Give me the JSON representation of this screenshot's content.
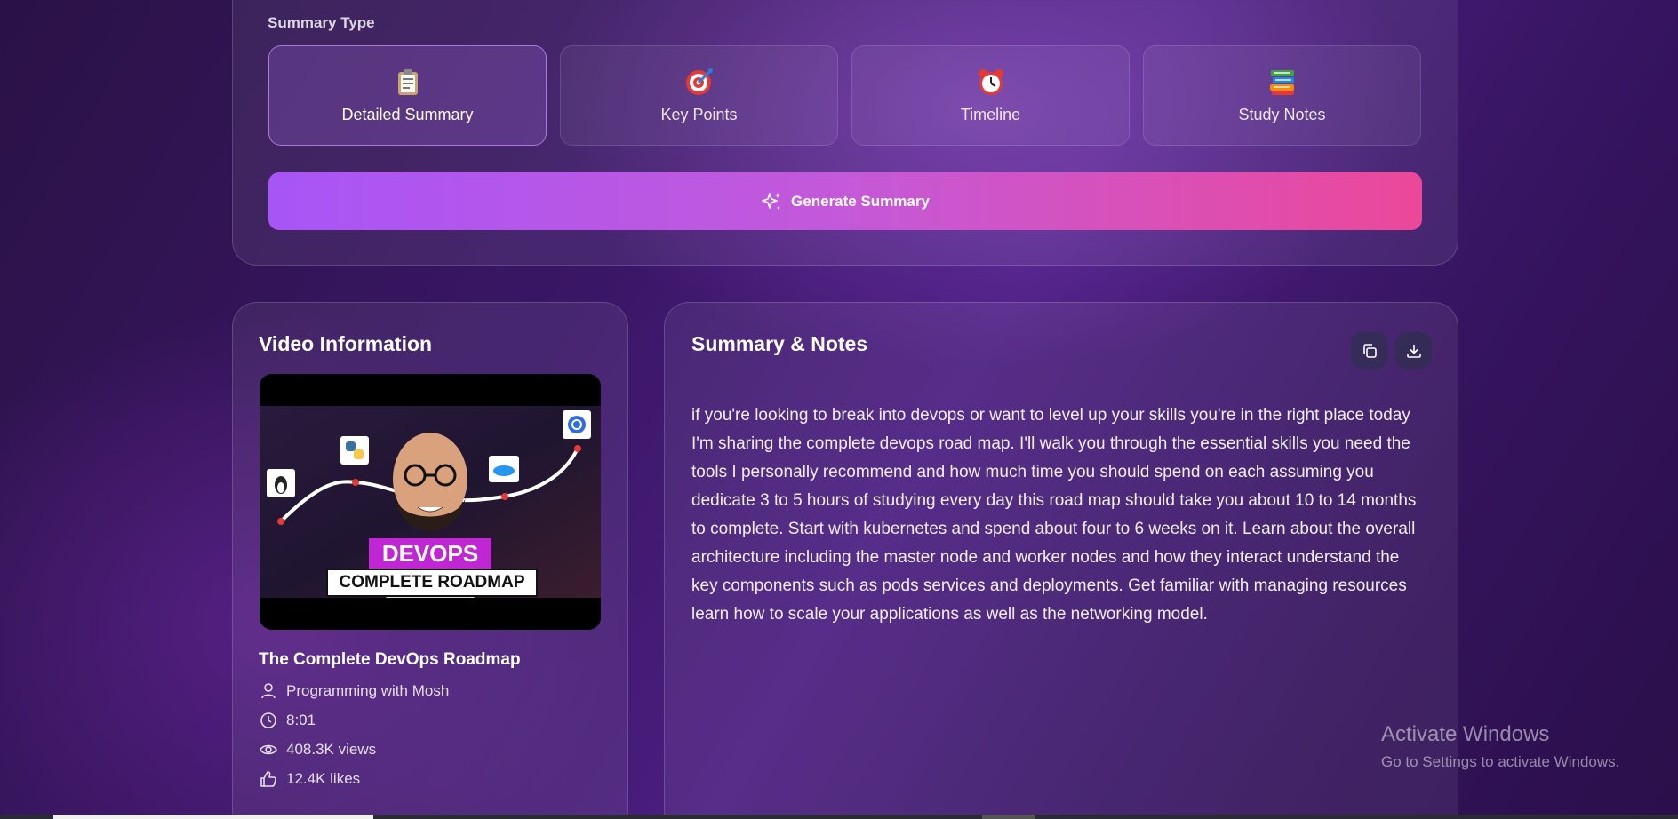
{
  "summary_type": {
    "label": "Summary Type",
    "options": [
      {
        "label": "Detailed Summary",
        "icon": "clipboard-icon",
        "selected": true
      },
      {
        "label": "Key Points",
        "icon": "target-icon",
        "selected": false
      },
      {
        "label": "Timeline",
        "icon": "alarm-clock-icon",
        "selected": false
      },
      {
        "label": "Study Notes",
        "icon": "books-icon",
        "selected": false
      }
    ]
  },
  "generate_button": {
    "label": "Generate Summary",
    "icon": "sparkles-icon"
  },
  "video_info": {
    "heading": "Video Information",
    "thumbnail": {
      "line1": "DEVOPS",
      "line2": "COMPLETE ROADMAP"
    },
    "title": "The Complete DevOps Roadmap",
    "channel": "Programming with Mosh",
    "duration": "8:01",
    "views": "408.3K views",
    "likes": "12.4K likes"
  },
  "summary": {
    "heading": "Summary & Notes",
    "copy_icon": "copy-icon",
    "download_icon": "download-icon",
    "text": "if you're looking to break into devops or want to level up your skills you're in the right place today I'm sharing the complete devops road map. I'll walk you through the essential skills you need the tools I personally recommend and how much time you should spend on each assuming you dedicate 3 to 5 hours of studying every day this road map should take you about 10 to 14 months to complete. Start with kubernetes and spend about four to 6 weeks on it. Learn about the overall architecture including the master node and worker nodes and how they interact understand the key components such as pods services and deployments. Get familiar with managing resources learn how to scale your applications as well as the networking model."
  },
  "watermark": {
    "title": "Activate Windows",
    "subtitle": "Go to Settings to activate Windows."
  },
  "colors": {
    "accent_start": "#a855f7",
    "accent_end": "#ec4899",
    "background": "#3a1666"
  }
}
